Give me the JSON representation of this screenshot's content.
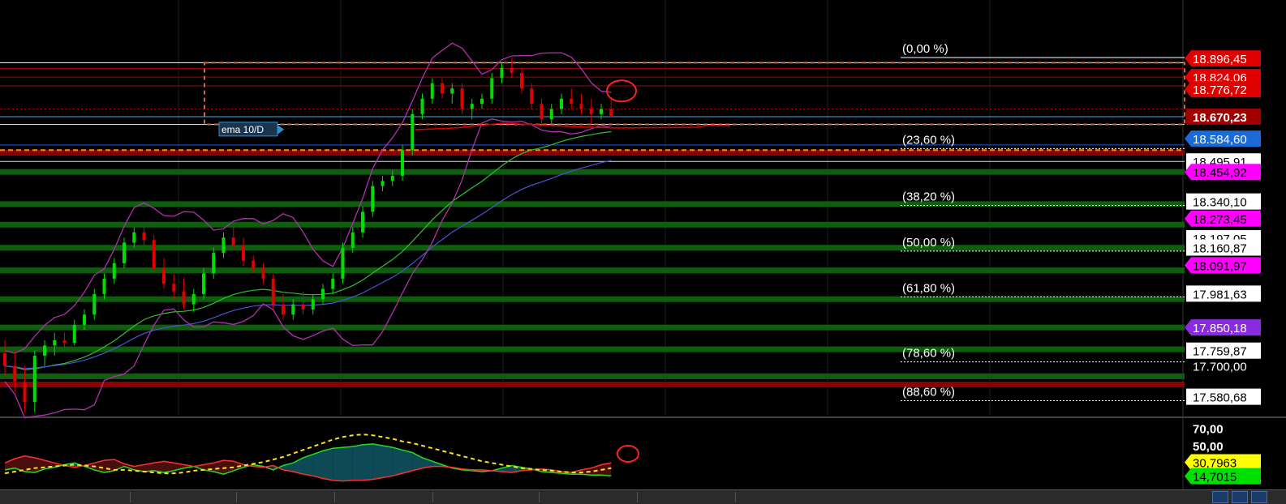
{
  "chart_data": {
    "type": "candlestick",
    "price_scale": {
      "min": 17510,
      "max": 18960
    },
    "oscillator_scale": {
      "min": 5,
      "max": 80
    },
    "reference_label": "ema 10/D",
    "fibonacci_levels": [
      {
        "label": "(0,00 %)",
        "price": 18900
      },
      {
        "label": "(23,60 %)",
        "price": 18546
      },
      {
        "label": "(38,20 %)",
        "price": 18325
      },
      {
        "label": "(50,00 %)",
        "price": 18147
      },
      {
        "label": "(61,80 %)",
        "price": 17969
      },
      {
        "label": "(78,60 %)",
        "price": 17716
      },
      {
        "label": "(88,60 %)",
        "price": 17565
      }
    ],
    "price_tags": [
      {
        "text": "18.896,45",
        "price": 18896.45,
        "style": "red"
      },
      {
        "text": "18.824,06",
        "price": 18824.06,
        "style": "red"
      },
      {
        "text": "18.776,72",
        "price": 18776.72,
        "style": "red"
      },
      {
        "text": "18.670,23",
        "price": 18670.23,
        "style": "darkred"
      },
      {
        "text": "18.584,60",
        "price": 18584.6,
        "style": "blue"
      },
      {
        "text": "18.495,91",
        "price": 18495.91,
        "style": "white"
      },
      {
        "text": "18.454,92",
        "price": 18454.92,
        "style": "magenta"
      },
      {
        "text": "18.340,10",
        "price": 18340.1,
        "style": "white"
      },
      {
        "text": "18.273,45",
        "price": 18273.45,
        "style": "magenta"
      },
      {
        "text": "18.197,05",
        "price": 18197.05,
        "style": "white"
      },
      {
        "text": "18.160,87",
        "price": 18160.87,
        "style": "white"
      },
      {
        "text": "18.091,97",
        "price": 18091.97,
        "style": "magenta"
      },
      {
        "text": "17.981,63",
        "price": 17981.63,
        "style": "white"
      },
      {
        "text": "17.850,18",
        "price": 17850.18,
        "style": "purple"
      },
      {
        "text": "17.759,87",
        "price": 17759.87,
        "style": "white"
      },
      {
        "text": "17.700,00",
        "price": 17700.0,
        "style": "plain"
      },
      {
        "text": "17.580,68",
        "price": 17580.68,
        "style": "white"
      }
    ],
    "oscillator_tags": [
      {
        "text": "70,00",
        "value": 70,
        "style": "plain"
      },
      {
        "text": "50,00",
        "value": 50,
        "style": "plain"
      },
      {
        "text": "30,7963",
        "value": 30.7963,
        "style": "yellow"
      },
      {
        "text": "14,7015",
        "value": 14.7015,
        "style": "green"
      }
    ],
    "horizontal_lines": [
      {
        "price": 18880,
        "color": "#ffffff",
        "kind": "thin"
      },
      {
        "price": 18858,
        "color": "#b00000",
        "kind": "thin"
      },
      {
        "price": 18824,
        "color": "#b00000",
        "kind": "thin"
      },
      {
        "price": 18790,
        "color": "#b00000",
        "kind": "thin"
      },
      {
        "price": 18700,
        "color": "#c00000",
        "kind": "dotted"
      },
      {
        "price": 18670,
        "color": "#4aa8d8",
        "kind": "thin"
      },
      {
        "price": 18640,
        "color": "#dddddd",
        "kind": "thin"
      },
      {
        "price": 18560,
        "color": "#2a5ad8",
        "kind": "thin"
      },
      {
        "price": 18520,
        "color": "#2a3ad8",
        "kind": "thin"
      },
      {
        "price": 18530,
        "color": "#8b0000",
        "kind": "band"
      },
      {
        "price": 18540,
        "color": "#ff8c00",
        "kind": "dashed"
      },
      {
        "price": 18496,
        "color": "#dddddd",
        "kind": "thin"
      },
      {
        "price": 18455,
        "color": "#0e5e0e",
        "kind": "band"
      },
      {
        "price": 18330,
        "color": "#0e5e0e",
        "kind": "band"
      },
      {
        "price": 18250,
        "color": "#0e5e0e",
        "kind": "band"
      },
      {
        "price": 18160,
        "color": "#0e5e0e",
        "kind": "band"
      },
      {
        "price": 18072,
        "color": "#0e5e0e",
        "kind": "band"
      },
      {
        "price": 17960,
        "color": "#0e5e0e",
        "kind": "band"
      },
      {
        "price": 17850,
        "color": "#0e5e0e",
        "kind": "band"
      },
      {
        "price": 17765,
        "color": "#0e5e0e",
        "kind": "band"
      },
      {
        "price": 17660,
        "color": "#0e5e0e",
        "kind": "band"
      },
      {
        "price": 17628,
        "color": "#8b0000",
        "kind": "band"
      }
    ],
    "candles": [
      [
        17750,
        17800,
        17660,
        17700
      ],
      [
        17700,
        17760,
        17600,
        17640
      ],
      [
        17640,
        17700,
        17520,
        17560
      ],
      [
        17560,
        17760,
        17520,
        17740
      ],
      [
        17740,
        17800,
        17700,
        17780
      ],
      [
        17780,
        17830,
        17740,
        17800
      ],
      [
        17800,
        17830,
        17760,
        17790
      ],
      [
        17790,
        17880,
        17780,
        17860
      ],
      [
        17860,
        17920,
        17840,
        17900
      ],
      [
        17900,
        18000,
        17880,
        17980
      ],
      [
        17980,
        18060,
        17960,
        18040
      ],
      [
        18040,
        18120,
        18020,
        18100
      ],
      [
        18100,
        18200,
        18080,
        18180
      ],
      [
        18180,
        18240,
        18160,
        18220
      ],
      [
        18220,
        18250,
        18170,
        18190
      ],
      [
        18190,
        18210,
        18060,
        18080
      ],
      [
        18080,
        18120,
        18000,
        18020
      ],
      [
        18020,
        18060,
        17960,
        17990
      ],
      [
        17990,
        18040,
        17920,
        17940
      ],
      [
        17940,
        18000,
        17910,
        17980
      ],
      [
        17980,
        18080,
        17960,
        18060
      ],
      [
        18060,
        18160,
        18040,
        18140
      ],
      [
        18140,
        18220,
        18120,
        18200
      ],
      [
        18200,
        18240,
        18150,
        18170
      ],
      [
        18170,
        18200,
        18090,
        18110
      ],
      [
        18110,
        18130,
        18060,
        18080
      ],
      [
        18080,
        18100,
        18020,
        18040
      ],
      [
        18040,
        18060,
        17920,
        17940
      ],
      [
        17940,
        17980,
        17880,
        17900
      ],
      [
        17900,
        17960,
        17880,
        17940
      ],
      [
        17940,
        17990,
        17900,
        17920
      ],
      [
        17920,
        17980,
        17900,
        17960
      ],
      [
        17960,
        18020,
        17940,
        18000
      ],
      [
        18000,
        18060,
        17980,
        18040
      ],
      [
        18040,
        18180,
        18020,
        18160
      ],
      [
        18160,
        18240,
        18140,
        18220
      ],
      [
        18220,
        18320,
        18200,
        18300
      ],
      [
        18300,
        18420,
        18280,
        18400
      ],
      [
        18400,
        18440,
        18380,
        18420
      ],
      [
        18420,
        18460,
        18400,
        18440
      ],
      [
        18440,
        18560,
        18420,
        18540
      ],
      [
        18540,
        18700,
        18520,
        18680
      ],
      [
        18680,
        18760,
        18660,
        18740
      ],
      [
        18740,
        18820,
        18720,
        18800
      ],
      [
        18800,
        18820,
        18740,
        18760
      ],
      [
        18760,
        18800,
        18720,
        18780
      ],
      [
        18780,
        18800,
        18680,
        18700
      ],
      [
        18700,
        18740,
        18660,
        18720
      ],
      [
        18720,
        18760,
        18700,
        18740
      ],
      [
        18740,
        18840,
        18720,
        18820
      ],
      [
        18820,
        18880,
        18800,
        18860
      ],
      [
        18860,
        18900,
        18820,
        18840
      ],
      [
        18840,
        18860,
        18760,
        18780
      ],
      [
        18780,
        18800,
        18700,
        18720
      ],
      [
        18720,
        18740,
        18640,
        18660
      ],
      [
        18660,
        18720,
        18640,
        18700
      ],
      [
        18700,
        18760,
        18680,
        18740
      ],
      [
        18740,
        18780,
        18700,
        18720
      ],
      [
        18720,
        18760,
        18680,
        18700
      ],
      [
        18700,
        18740,
        18640,
        18680
      ],
      [
        18680,
        18720,
        18660,
        18700
      ],
      [
        18700,
        18740,
        18690,
        18670
      ]
    ],
    "oscillator_series": [
      {
        "name": "",
        "color": "#22dd22",
        "values": [
          22,
          24,
          20,
          19,
          23,
          25,
          28,
          30,
          26,
          22,
          19,
          21,
          26,
          22,
          20,
          21,
          19,
          21,
          24,
          26,
          22,
          20,
          17,
          21,
          25,
          28,
          26,
          22,
          27,
          30,
          36,
          40,
          44,
          47,
          48,
          49,
          51,
          52,
          50,
          48,
          45,
          42,
          36,
          32,
          28,
          24,
          22,
          21,
          20,
          21,
          24,
          27,
          25,
          23,
          20,
          19,
          18,
          17,
          17,
          16,
          16,
          15
        ]
      },
      {
        "name": "",
        "color": "#ff3030",
        "values": [
          30,
          35,
          38,
          36,
          33,
          30,
          27,
          25,
          27,
          30,
          33,
          34,
          29,
          26,
          28,
          30,
          32,
          30,
          28,
          26,
          28,
          30,
          33,
          32,
          28,
          26,
          25,
          27,
          22,
          20,
          17,
          15,
          12,
          10,
          9,
          10,
          10,
          11,
          13,
          15,
          18,
          21,
          24,
          26,
          26,
          25,
          23,
          22,
          22,
          21,
          20,
          19,
          21,
          22,
          23,
          22,
          20,
          19,
          22,
          24,
          28,
          30
        ]
      },
      {
        "name": "",
        "color": "#ffe020",
        "dashed": true,
        "values": [
          18,
          20,
          22,
          24,
          25,
          26,
          27,
          28,
          27,
          26,
          24,
          22,
          22,
          21,
          20,
          19,
          18,
          18,
          19,
          21,
          22,
          23,
          24,
          25,
          27,
          29,
          31,
          34,
          37,
          41,
          45,
          49,
          53,
          57,
          60,
          62,
          63,
          62,
          60,
          58,
          55,
          53,
          50,
          47,
          44,
          41,
          38,
          35,
          32,
          30,
          28,
          26,
          24,
          23,
          22,
          21,
          20,
          19,
          19,
          20,
          22,
          24
        ]
      }
    ],
    "colors": {
      "up_candle": "#00dd00",
      "down_candle": "#e00000",
      "bollinger": "#b030b0",
      "ema_green": "#30c030",
      "ema_blue": "#5050d8",
      "grid": "#1e1e1e",
      "fib_line": "#ffffff"
    }
  }
}
